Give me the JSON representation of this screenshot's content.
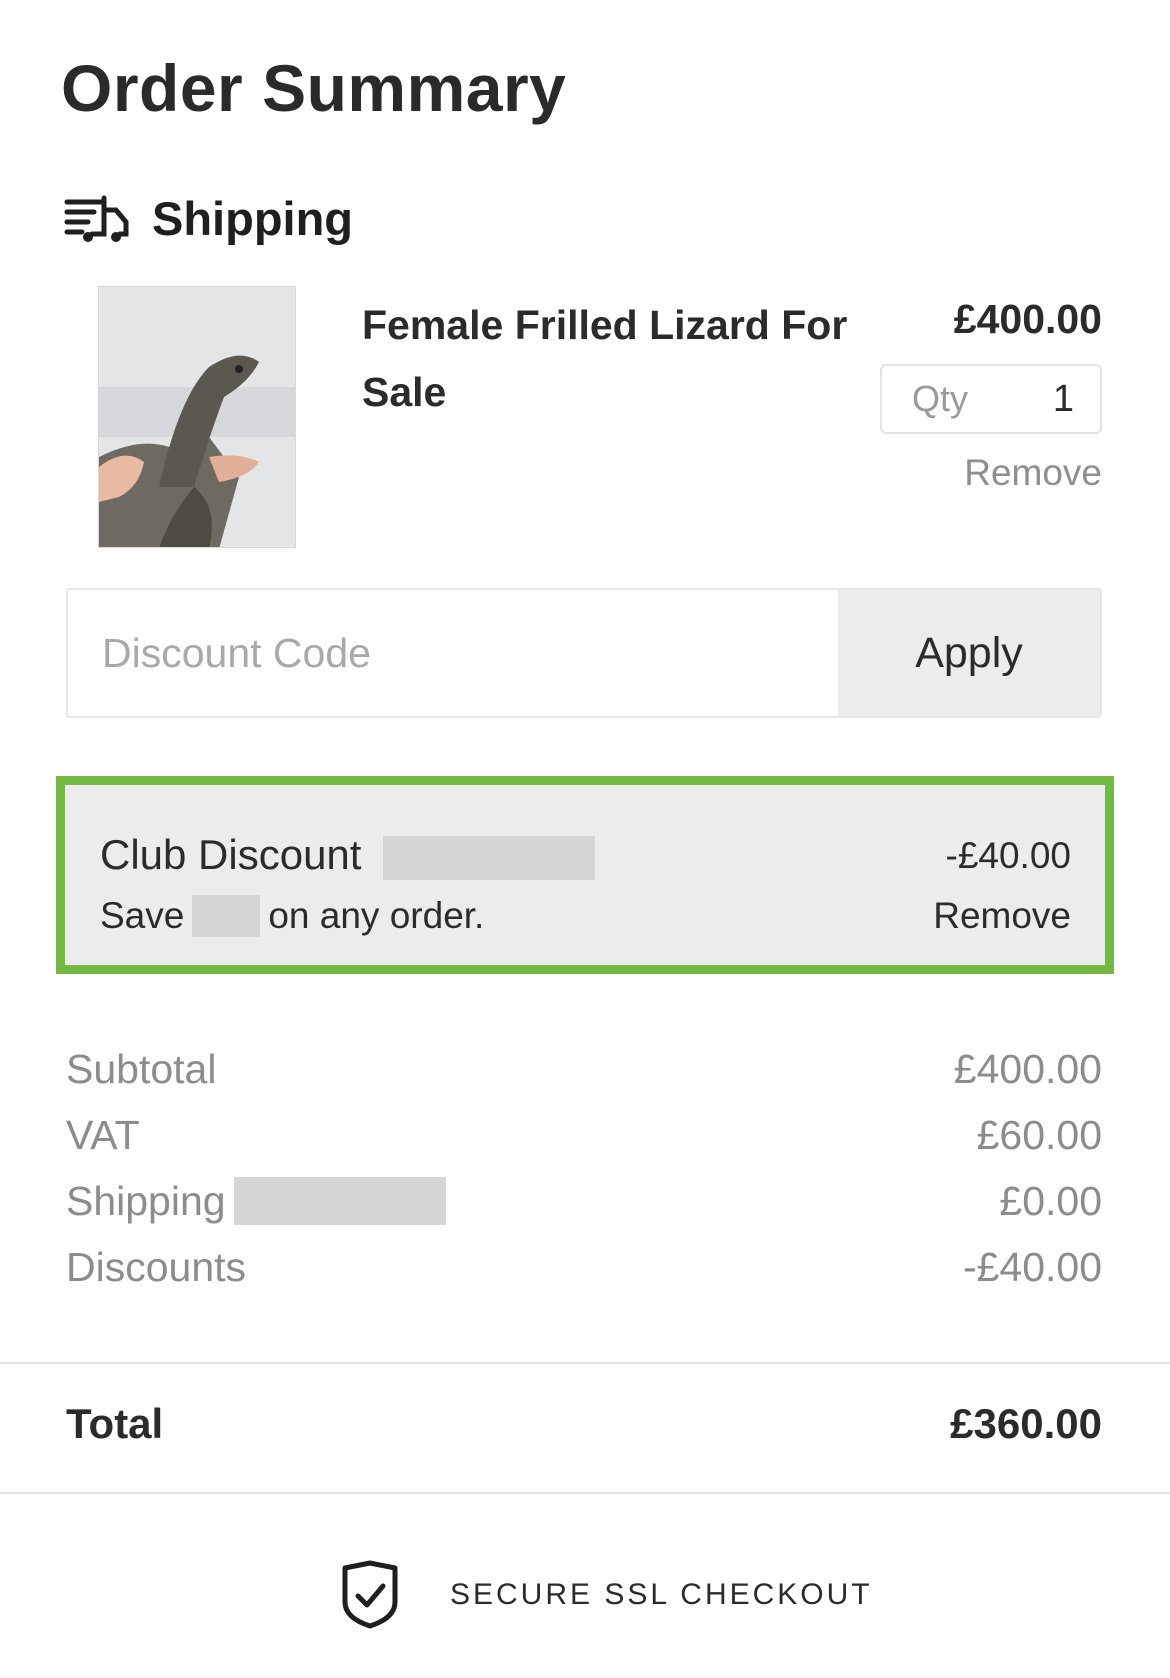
{
  "title": "Order Summary",
  "shipping_section": {
    "label": "Shipping",
    "icon": "delivery-truck-icon"
  },
  "item": {
    "name": "Female Frilled Lizard For Sale",
    "price": "£400.00",
    "qty_label": "Qty",
    "qty_value": "1",
    "remove_label": "Remove"
  },
  "discount": {
    "placeholder": "Discount Code",
    "apply_label": "Apply"
  },
  "club_discount": {
    "name": "Club Discount",
    "save_prefix": "Save",
    "save_suffix": "on any order.",
    "amount": "-£40.00",
    "remove_label": "Remove",
    "highlight_color": "#74b944"
  },
  "totals": {
    "subtotal_label": "Subtotal",
    "subtotal_value": "£400.00",
    "vat_label": "VAT",
    "vat_value": "£60.00",
    "shipping_label": "Shipping",
    "shipping_value": "£0.00",
    "discounts_label": "Discounts",
    "discounts_value": "-£40.00"
  },
  "total": {
    "label": "Total",
    "value": "£360.00"
  },
  "secure": {
    "label": "SECURE SSL CHECKOUT",
    "icon": "shield-check-icon"
  }
}
